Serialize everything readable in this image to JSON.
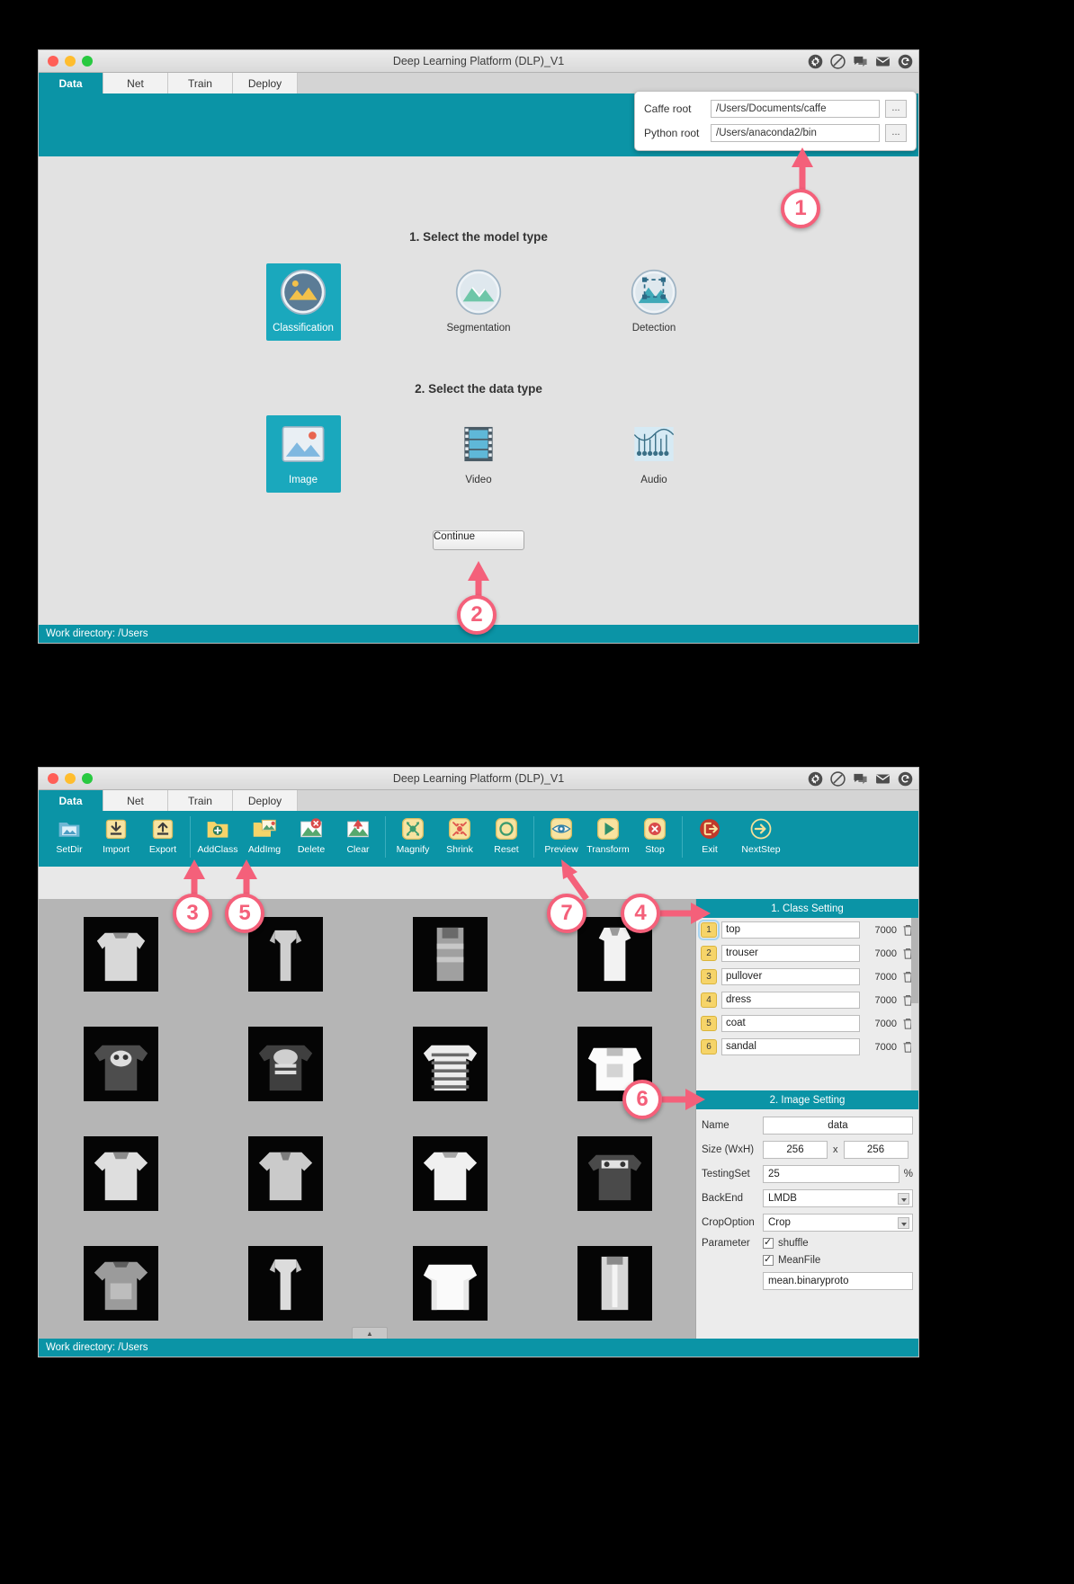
{
  "app": {
    "title": "Deep Learning Platform (DLP)_V1",
    "tabs": [
      "Data",
      "Net",
      "Train",
      "Deploy"
    ],
    "active_tab": "Data",
    "status_bar": "Work directory:  /Users",
    "accent_color": "#0b94a6",
    "callout_color": "#f4607a",
    "titlebar_icons": [
      "gear-icon",
      "no-entry-icon",
      "chat-icon",
      "mail-icon",
      "refresh-icon"
    ]
  },
  "window1": {
    "settings_popover": {
      "caffe_root_label": "Caffe root",
      "caffe_root_value": "/Users/Documents/caffe",
      "python_root_label": "Python root",
      "python_root_value": "/Users/anaconda2/bin",
      "browse_label": "..."
    },
    "step1": {
      "heading": "1. Select the model type",
      "options": [
        {
          "label": "Classification",
          "icon": "classification-icon",
          "selected": true
        },
        {
          "label": "Segmentation",
          "icon": "segmentation-icon",
          "selected": false
        },
        {
          "label": "Detection",
          "icon": "detection-icon",
          "selected": false
        }
      ]
    },
    "step2": {
      "heading": "2. Select the data type",
      "options": [
        {
          "label": "Image",
          "icon": "image-icon",
          "selected": true
        },
        {
          "label": "Video",
          "icon": "video-icon",
          "selected": false
        },
        {
          "label": "Audio",
          "icon": "audio-icon",
          "selected": false
        }
      ]
    },
    "continue_label": "Continue"
  },
  "window2": {
    "toolbar": [
      {
        "label": "SetDir",
        "icon": "folder-image-icon"
      },
      {
        "label": "Import",
        "icon": "import-download-icon"
      },
      {
        "label": "Export",
        "icon": "export-upload-icon"
      },
      {
        "label": "AddClass",
        "icon": "folder-plus-icon"
      },
      {
        "label": "AddImg",
        "icon": "folder-image-add-icon"
      },
      {
        "label": "Delete",
        "icon": "image-delete-icon"
      },
      {
        "label": "Clear",
        "icon": "image-clear-icon"
      },
      {
        "label": "Magnify",
        "icon": "magnify-icon"
      },
      {
        "label": "Shrink",
        "icon": "shrink-icon"
      },
      {
        "label": "Reset",
        "icon": "reset-circle-icon"
      },
      {
        "label": "Preview",
        "icon": "eye-preview-icon"
      },
      {
        "label": "Transform",
        "icon": "play-transform-icon"
      },
      {
        "label": "Stop",
        "icon": "stop-x-icon"
      },
      {
        "label": "Exit",
        "icon": "exit-icon"
      },
      {
        "label": "NextStep",
        "icon": "arrow-right-circle-icon"
      }
    ],
    "class_setting": {
      "heading": "1. Class Setting",
      "rows": [
        {
          "index": "1",
          "name": "top",
          "count": "7000",
          "selected": true
        },
        {
          "index": "2",
          "name": "trouser",
          "count": "7000",
          "selected": false
        },
        {
          "index": "3",
          "name": "pullover",
          "count": "7000",
          "selected": false
        },
        {
          "index": "4",
          "name": "dress",
          "count": "7000",
          "selected": false
        },
        {
          "index": "5",
          "name": "coat",
          "count": "7000",
          "selected": false
        },
        {
          "index": "6",
          "name": "sandal",
          "count": "7000",
          "selected": false
        }
      ],
      "delete_icon": "trash-icon"
    },
    "image_setting": {
      "heading": "2. Image Setting",
      "name_label": "Name",
      "name_value": "data",
      "size_label": "Size (WxH)",
      "size_w": "256",
      "size_sep": "x",
      "size_h": "256",
      "testingset_label": "TestingSet",
      "testingset_value": "25",
      "testingset_unit": "%",
      "backend_label": "BackEnd",
      "backend_value": "LMDB",
      "cropoption_label": "CropOption",
      "cropoption_value": "Crop",
      "parameter_label": "Parameter",
      "shuffle_label": "shuffle",
      "shuffle_checked": true,
      "meanfile_label": "MeanFile",
      "meanfile_checked": true,
      "meanfile_value": "mean.binaryproto"
    },
    "grid_collapse_icon": "chevron-up-icon"
  },
  "callouts": [
    {
      "number": "1",
      "target": "python-root-field"
    },
    {
      "number": "2",
      "target": "continue-button"
    },
    {
      "number": "3",
      "target": "addclass-button"
    },
    {
      "number": "4",
      "target": "class-row-1"
    },
    {
      "number": "5",
      "target": "addimg-button"
    },
    {
      "number": "6",
      "target": "image-setting-name"
    },
    {
      "number": "7",
      "target": "transform-button"
    }
  ]
}
